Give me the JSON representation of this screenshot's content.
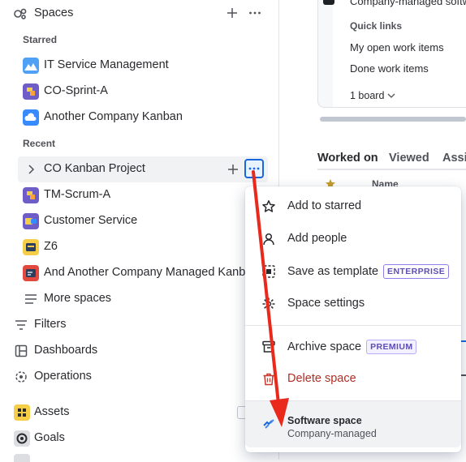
{
  "sidebar": {
    "spaces_heading": "Spaces",
    "starred_heading": "Starred",
    "starred": [
      {
        "label": "IT Service Management",
        "icon": "it-service-management-icon"
      },
      {
        "label": "CO-Sprint-A",
        "icon": "co-sprint-a-icon"
      },
      {
        "label": "Another Company Kanban",
        "icon": "another-company-kanban-icon"
      }
    ],
    "recent_heading": "Recent",
    "recent": [
      {
        "label": "CO Kanban Project",
        "icon": "co-kanban-project-icon"
      },
      {
        "label": "TM-Scrum-A",
        "icon": "tm-scrum-a-icon"
      },
      {
        "label": "Customer Service",
        "icon": "customer-service-icon"
      },
      {
        "label": "Z6",
        "icon": "z6-icon"
      },
      {
        "label": "And Another Company Managed Kanban",
        "icon": "and-another-company-managed-kanban-icon"
      }
    ],
    "more_spaces": "More spaces",
    "nav": [
      {
        "label": "Filters",
        "icon": "filter-icon"
      },
      {
        "label": "Dashboards",
        "icon": "dashboard-icon"
      },
      {
        "label": "Operations",
        "icon": "operations-icon"
      },
      {
        "label": "Assets",
        "icon": "assets-icon"
      },
      {
        "label": "Goals",
        "icon": "goals-icon"
      }
    ]
  },
  "right_panel": {
    "top_text": "Company-managed softw",
    "quick_links_heading": "Quick links",
    "links": [
      "My open work items",
      "Done work items"
    ],
    "board_select": "1 board",
    "tabs": [
      "Worked on",
      "Viewed",
      "Assi"
    ],
    "table_header": "Name"
  },
  "menu": {
    "items": [
      {
        "label": "Add to starred",
        "icon": "star-icon"
      },
      {
        "label": "Add people",
        "icon": "person-icon"
      },
      {
        "label": "Save as template",
        "icon": "template-icon",
        "badge": "ENTERPRISE"
      },
      {
        "label": "Space settings",
        "icon": "settings-icon"
      },
      {
        "label": "Archive space",
        "icon": "archive-icon",
        "badge": "PREMIUM"
      },
      {
        "label": "Delete space",
        "icon": "trash-icon"
      }
    ],
    "footer_title": "Software space",
    "footer_subtitle": "Company-managed"
  },
  "colors": {
    "accent": "#1868db",
    "danger": "#ae2e24",
    "annotation_arrow": "#e8291c",
    "hover_row": "#f1f2f4"
  }
}
